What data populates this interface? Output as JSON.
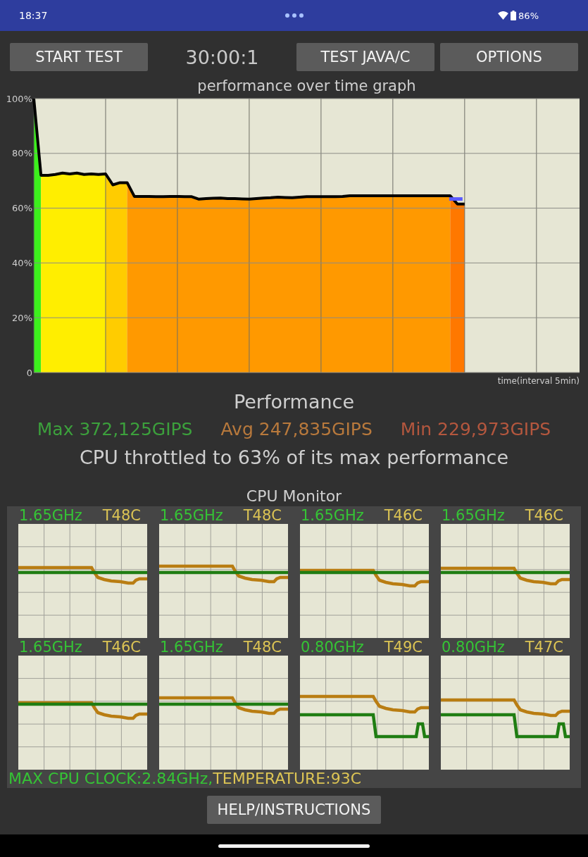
{
  "status_bar": {
    "time": "18:37",
    "battery": "86%"
  },
  "toolbar": {
    "start_button": "START TEST",
    "timer": "30:00:1",
    "buttons": [
      "TEST JAVA/C",
      "OPTIONS"
    ]
  },
  "performance_graph": {
    "chart_data": {
      "type": "area",
      "title": "performance over time graph",
      "xlabel": "time(interval 5min)",
      "categories": [
        null,
        null,
        null,
        null,
        null,
        null,
        null,
        null,
        null,
        null,
        null,
        null,
        null,
        null,
        null,
        null,
        null,
        null,
        null,
        null,
        null,
        null,
        null,
        null,
        null,
        null,
        null,
        null,
        null,
        null,
        null,
        null,
        null,
        null,
        null,
        null,
        null,
        null,
        null,
        null,
        null,
        null,
        null,
        null,
        null,
        null,
        null,
        null,
        null,
        null,
        null,
        null,
        null,
        null,
        null,
        null,
        null,
        null,
        null,
        null,
        null,
        null,
        null,
        null,
        null,
        null,
        null,
        null,
        null,
        null,
        null,
        null,
        null,
        null,
        null,
        null,
        null
      ],
      "series": [
        {
          "color": "#3cf01c",
          "values": [
            100,
            72,
            null,
            null,
            null,
            null,
            null,
            null,
            null,
            null,
            null,
            null,
            null,
            null,
            null,
            null,
            null,
            null,
            null,
            null,
            null,
            null,
            null,
            null,
            null,
            null,
            null,
            null,
            null,
            null,
            null,
            null,
            null,
            null,
            null,
            null,
            null,
            null,
            null,
            null,
            null,
            null,
            null,
            null,
            null,
            null,
            null,
            null,
            null,
            null,
            null,
            null,
            null,
            null,
            null,
            null,
            null,
            null,
            null,
            null,
            null,
            null,
            null,
            null,
            null,
            null,
            null,
            null,
            null,
            null,
            null,
            null,
            null,
            null,
            null,
            null,
            null
          ]
        },
        {
          "color": "#ffee00",
          "values": [
            null,
            72,
            72,
            72.3,
            72.8,
            72.5,
            72.8,
            72.3,
            72.5,
            72.3,
            72.5,
            null,
            null,
            null,
            null,
            null,
            null,
            null,
            null,
            null,
            null,
            null,
            null,
            null,
            null,
            null,
            null,
            null,
            null,
            null,
            null,
            null,
            null,
            null,
            null,
            null,
            null,
            null,
            null,
            null,
            null,
            null,
            null,
            null,
            null,
            null,
            null,
            null,
            null,
            null,
            null,
            null,
            null,
            null,
            null,
            null,
            null,
            null,
            null,
            null,
            null,
            null,
            null,
            null,
            null,
            null,
            null,
            null,
            null,
            null,
            null,
            null,
            null,
            null,
            null,
            null,
            null
          ]
        },
        {
          "color": "#ffcc00",
          "values": [
            null,
            null,
            null,
            null,
            null,
            null,
            null,
            null,
            null,
            null,
            72.5,
            68.5,
            69.3,
            69.3,
            null,
            null,
            null,
            null,
            null,
            null,
            null,
            null,
            null,
            null,
            null,
            null,
            null,
            null,
            null,
            null,
            null,
            null,
            null,
            null,
            null,
            null,
            null,
            null,
            null,
            null,
            null,
            null,
            null,
            null,
            null,
            null,
            null,
            null,
            null,
            null,
            null,
            null,
            null,
            null,
            null,
            null,
            null,
            null,
            null,
            null,
            null,
            null,
            null,
            null,
            null,
            null,
            null,
            null,
            null,
            null,
            null,
            null,
            null,
            null,
            null,
            null,
            null
          ]
        },
        {
          "color": "#ff9900",
          "values": [
            null,
            null,
            null,
            null,
            null,
            null,
            null,
            null,
            null,
            null,
            null,
            null,
            null,
            69.3,
            64.3,
            64.3,
            64.3,
            64.2,
            64.2,
            64.3,
            64.3,
            64.2,
            64.2,
            63.3,
            63.5,
            63.6,
            63.7,
            63.5,
            63.5,
            63.4,
            63.3,
            63.5,
            63.7,
            63.8,
            64,
            63.9,
            63.8,
            64,
            64.2,
            64.2,
            64.2,
            64.2,
            64.2,
            64.3,
            64.5,
            64.5,
            64.5,
            64.5,
            64.5,
            64.5,
            64.5,
            64.5,
            64.5,
            64.5,
            64.5,
            64.5,
            64.5,
            64.5,
            64.5,
            null,
            null,
            null,
            null,
            null,
            null,
            null,
            null,
            null,
            null,
            null,
            null,
            null,
            null,
            null,
            null,
            null,
            null
          ]
        },
        {
          "color": "#ff7800",
          "values": [
            null,
            null,
            null,
            null,
            null,
            null,
            null,
            null,
            null,
            null,
            null,
            null,
            null,
            null,
            null,
            null,
            null,
            null,
            null,
            null,
            null,
            null,
            null,
            null,
            null,
            null,
            null,
            null,
            null,
            null,
            null,
            null,
            null,
            null,
            null,
            null,
            null,
            null,
            null,
            null,
            null,
            null,
            null,
            null,
            null,
            null,
            null,
            null,
            null,
            null,
            null,
            null,
            null,
            null,
            null,
            null,
            null,
            null,
            64.5,
            61.5,
            61.5,
            null,
            null,
            null,
            null,
            null,
            null,
            null,
            null,
            null,
            null,
            null,
            null,
            null,
            null,
            null,
            null
          ]
        },
        {
          "type": "line",
          "color": "#000000",
          "values": [
            100,
            72,
            72,
            72.3,
            72.8,
            72.5,
            72.8,
            72.3,
            72.5,
            72.3,
            72.5,
            68.5,
            69.3,
            69.3,
            64.3,
            64.3,
            64.3,
            64.2,
            64.2,
            64.3,
            64.3,
            64.2,
            64.2,
            63.3,
            63.5,
            63.6,
            63.7,
            63.5,
            63.5,
            63.4,
            63.3,
            63.5,
            63.7,
            63.8,
            64,
            63.9,
            63.8,
            64,
            64.2,
            64.2,
            64.2,
            64.2,
            64.2,
            64.3,
            64.5,
            64.5,
            64.5,
            64.5,
            64.5,
            64.5,
            64.5,
            64.5,
            64.5,
            64.5,
            64.5,
            64.5,
            64.5,
            64.5,
            64.5,
            61.5,
            61.5,
            null,
            null,
            null,
            null,
            null,
            null,
            null,
            null,
            null,
            null,
            null,
            null,
            null,
            null,
            null,
            null
          ]
        }
      ],
      "ylim": [
        0,
        100
      ],
      "yticks": [
        {
          "value": 0,
          "label": "0"
        },
        {
          "value": 20,
          "label": "20%"
        },
        {
          "value": 40,
          "label": "40%"
        },
        {
          "value": 60,
          "label": "60%"
        },
        {
          "value": 80,
          "label": "80%"
        },
        {
          "value": 100,
          "label": "100%"
        }
      ],
      "grid": true
    }
  },
  "performance": {
    "heading": "Performance",
    "stats": [
      {
        "label": "Max 372,125GIPS",
        "color": "#3ca03c"
      },
      {
        "label": "Avg 247,835GIPS",
        "color": "#b8793c"
      },
      {
        "label": "Min 229,973GIPS",
        "color": "#b4573e"
      }
    ],
    "summary": "CPU throttled to 63% of its max performance"
  },
  "cpu_monitor": {
    "title": "CPU Monitor",
    "cores": [
      {
        "frequency": "1.65GHz",
        "temperature": "T48C"
      },
      {
        "frequency": "1.65GHz",
        "temperature": "T48C"
      },
      {
        "frequency": "1.65GHz",
        "temperature": "T46C"
      },
      {
        "frequency": "1.65GHz",
        "temperature": "T46C"
      },
      {
        "frequency": "1.65GHz",
        "temperature": "T46C"
      },
      {
        "frequency": "1.65GHz",
        "temperature": "T48C"
      },
      {
        "frequency": "0.80GHz",
        "temperature": "T49C"
      },
      {
        "frequency": "0.80GHz",
        "temperature": "T47C"
      }
    ],
    "max_clock": "MAX CPU CLOCK:2.84GHz,",
    "max_temperature": "TEMPERATURE:93C"
  },
  "help_button": "HELP/INSTRUCTIONS"
}
